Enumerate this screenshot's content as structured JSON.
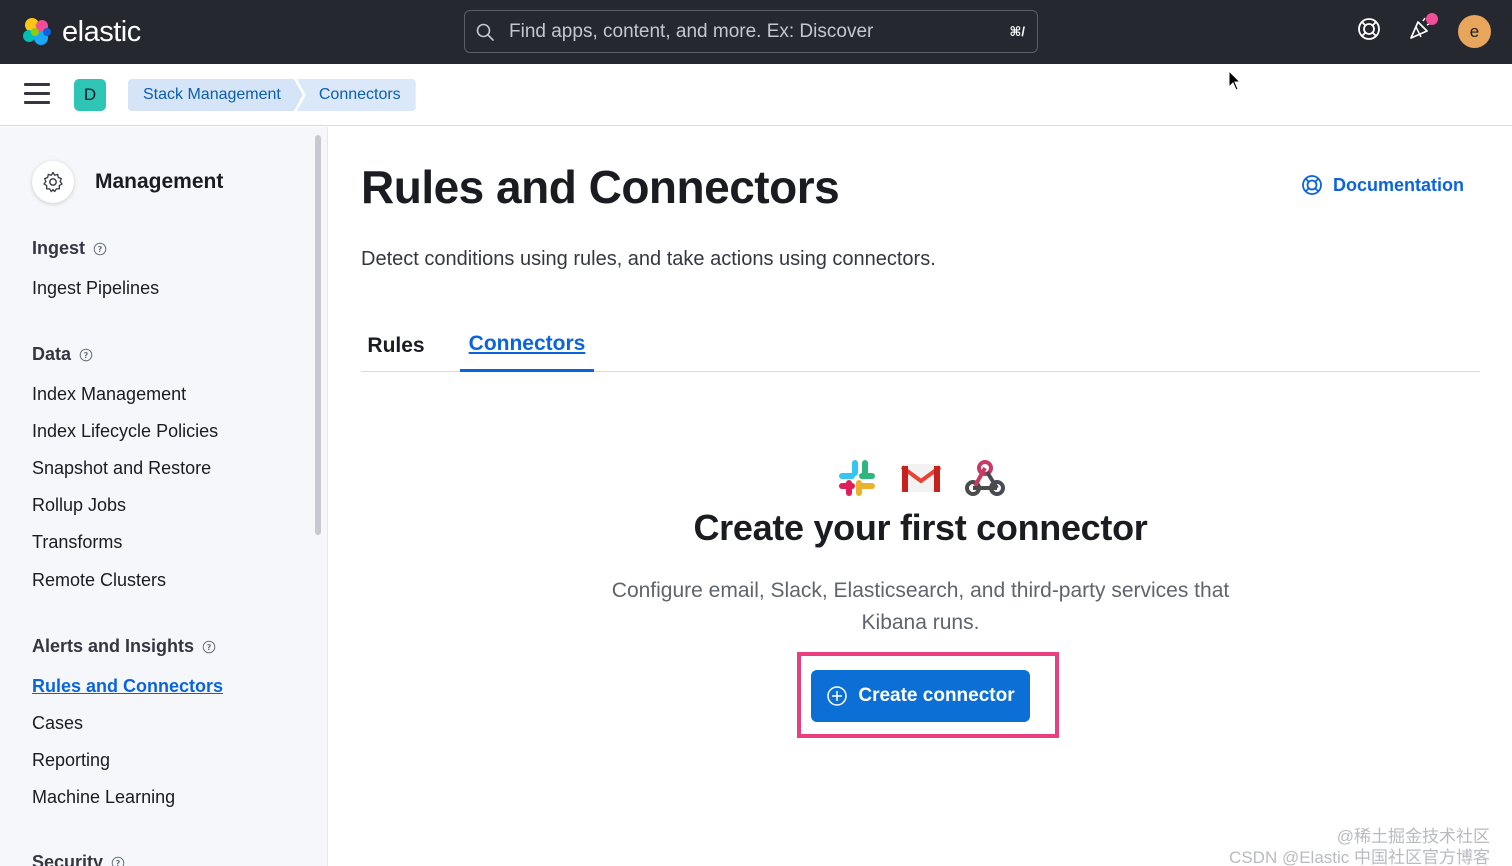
{
  "brand": {
    "name": "elastic"
  },
  "search": {
    "placeholder": "Find apps, content, and more. Ex: Discover",
    "shortcut": "⌘/"
  },
  "header": {
    "avatar_letter": "e"
  },
  "breadcrumbs": {
    "space_letter": "D",
    "items": [
      "Stack Management",
      "Connectors"
    ]
  },
  "sidebar": {
    "title": "Management",
    "groups": [
      {
        "label": "Ingest",
        "items": [
          "Ingest Pipelines"
        ]
      },
      {
        "label": "Data",
        "items": [
          "Index Management",
          "Index Lifecycle Policies",
          "Snapshot and Restore",
          "Rollup Jobs",
          "Transforms",
          "Remote Clusters"
        ]
      },
      {
        "label": "Alerts and Insights",
        "items": [
          "Rules and Connectors",
          "Cases",
          "Reporting",
          "Machine Learning"
        ]
      },
      {
        "label": "Security",
        "items": []
      }
    ],
    "active_item": "Rules and Connectors"
  },
  "main": {
    "title": "Rules and Connectors",
    "documentation_label": "Documentation",
    "description": "Detect conditions using rules, and take actions using connectors.",
    "tabs": [
      {
        "label": "Rules",
        "selected": false
      },
      {
        "label": "Connectors",
        "selected": true
      }
    ],
    "empty_state": {
      "icons": [
        "slack-icon",
        "gmail-icon",
        "webhook-icon"
      ],
      "title": "Create your first connector",
      "body": "Configure email, Slack, Elasticsearch, and third-party services that Kibana runs.",
      "button_label": "Create connector"
    }
  },
  "watermark": {
    "line1": "@稀土掘金技术社区",
    "line2": "CSDN @Elastic 中国社区官方博客"
  },
  "colors": {
    "header_bg": "#25282f",
    "accent": "#0b64dd",
    "button": "#0b6fd6",
    "highlight": "#e8407f",
    "notification_dot": "#f04e98"
  }
}
